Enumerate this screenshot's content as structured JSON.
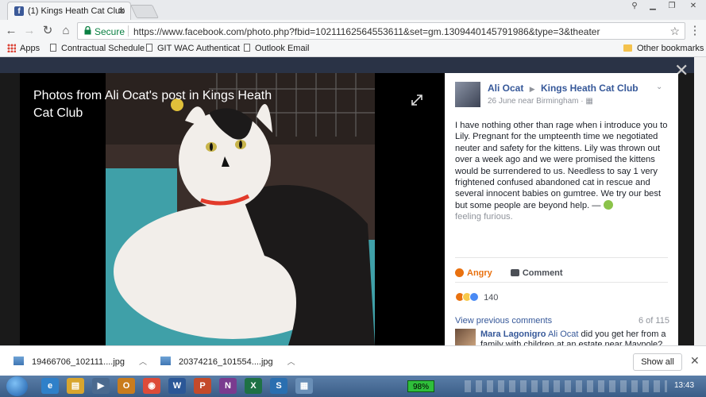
{
  "browser": {
    "tab_title": "(1) Kings Heath Cat Club",
    "security_label": "Secure",
    "url": "https://www.facebook.com/photo.php?fbid=10211162564553611&set=gm.1309440145791986&type=3&theater",
    "bookmarks": {
      "apps": "Apps",
      "items": [
        "Contractual Schedule",
        "GIT WAC Authenticat",
        "Outlook Email"
      ],
      "other": "Other bookmarks"
    }
  },
  "photo": {
    "caption": "Photos from Ali Ocat's post in Kings Heath Cat Club"
  },
  "post": {
    "author": "Ali Ocat",
    "group": "Kings Heath Cat Club",
    "meta": "26 June near Birmingham · ",
    "text": "I have nothing other than rage when i introduce you to Lily. Pregnant for the umpteenth time we negotiated neuter and safety for the kittens. Lily was thrown out over a week ago and we were promised the kittens would be surrendered to us. Needless to say 1 very frightened confused abandoned cat in rescue and several innocent babies on gumtree. We try our best but some people are beyond help. — ",
    "feeling": "feeling furious.",
    "actions": {
      "angry": "Angry",
      "comment": "Comment"
    },
    "reaction_count": "140",
    "view_previous": "View previous comments",
    "comment_count": "6 of 115",
    "comment": {
      "author": "Mara Lagonigro",
      "mention": "Ali Ocat",
      "text": " did you get her from a family with children at an estate near Maypole?"
    }
  },
  "downloads": {
    "files": [
      "19466706_102111....jpg",
      "20374216_101554....jpg"
    ],
    "show_all": "Show all"
  },
  "taskbar": {
    "battery": "98%",
    "time": "13:43"
  },
  "colors": {
    "facebook_blue": "#365899",
    "angry_orange": "#e9710f",
    "secure_green": "#0b8043"
  }
}
